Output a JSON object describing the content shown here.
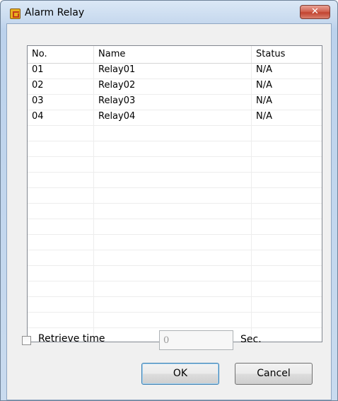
{
  "window": {
    "title": "Alarm Relay",
    "close_glyph": "✕",
    "app_icon": "alarm-relay-app-icon",
    "close_icon": "close-icon",
    "colors": {
      "title_gradient_top": "#dbe8f6",
      "close_button_red": "#c24430",
      "client_background": "#f0f0f0"
    }
  },
  "list": {
    "columns": {
      "no": "No.",
      "name": "Name",
      "status": "Status"
    },
    "rows": [
      {
        "no": "01",
        "name": "Relay01",
        "status": "N/A"
      },
      {
        "no": "02",
        "name": "Relay02",
        "status": "N/A"
      },
      {
        "no": "03",
        "name": "Relay03",
        "status": "N/A"
      },
      {
        "no": "04",
        "name": "Relay04",
        "status": "N/A"
      }
    ]
  },
  "retrieve": {
    "label": "Retrieve time",
    "checked": false,
    "value": "0",
    "unit": "Sec."
  },
  "buttons": {
    "ok": "OK",
    "cancel": "Cancel"
  }
}
